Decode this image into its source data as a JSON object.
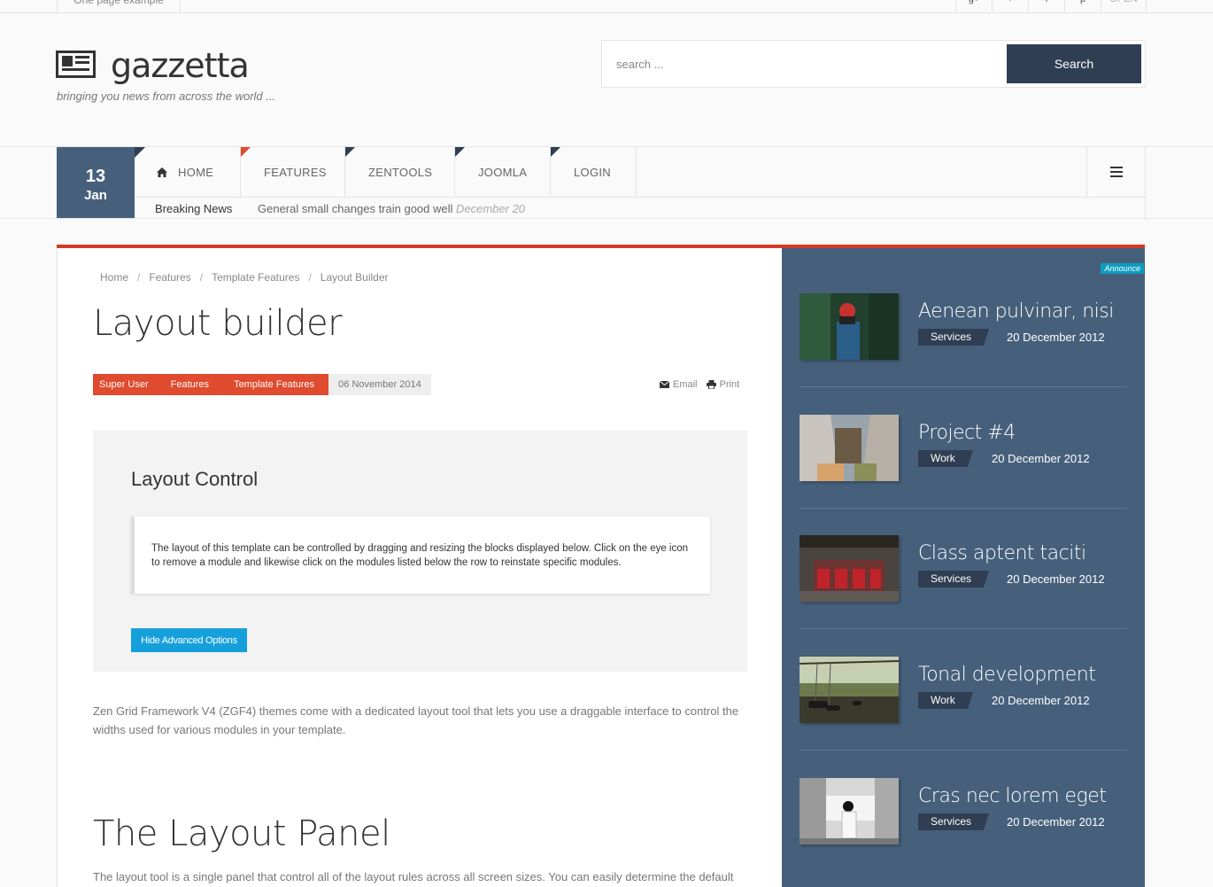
{
  "topbar": {
    "onepage": "One page example",
    "open": "OPEN"
  },
  "header": {
    "logo": "gazzetta",
    "tagline": "bringing you news from across the world ...",
    "search_placeholder": "search ...",
    "search_button": "Search"
  },
  "date": {
    "day": "13",
    "month": "Jan"
  },
  "menu": {
    "items": [
      {
        "label": "HOME",
        "icon": "home-icon"
      },
      {
        "label": "FEATURES"
      },
      {
        "label": "ZENTOOLS"
      },
      {
        "label": "JOOMLA"
      },
      {
        "label": "LOGIN"
      }
    ]
  },
  "breaking": {
    "label": "Breaking News",
    "text": "General small changes train good well",
    "date": "December 20"
  },
  "article": {
    "breadcrumb": [
      "Home",
      "Features",
      "Template Features",
      "Layout Builder"
    ],
    "title": "Layout builder",
    "author": "Super User",
    "cat1": "Features",
    "cat2": "Template Features",
    "date": "06 November 2014",
    "email": "Email",
    "print": "Print",
    "shot": {
      "heading": "Layout Control",
      "text": "The layout of this template can be controlled by dragging and resizing the blocks displayed below. Click on the eye icon to remove a module and likewise click on the modules listed below the row to reinstate specific modules.",
      "button": "Hide Advanced Options"
    },
    "para1": "Zen Grid Framework V4 (ZGF4) themes come with a dedicated layout tool that lets you use a draggable interface to control the widths used for various modules in your template.",
    "h2": "The Layout Panel",
    "para2": "The layout tool is a single panel that control all of the layout rules across all screen sizes. You can easily determine the default"
  },
  "sidebar": {
    "badge": "Announce",
    "posts": [
      {
        "title": "Aenean pulvinar, nisi",
        "cat": "Services",
        "date": "20 December 2012"
      },
      {
        "title": "Project #4",
        "cat": "Work",
        "date": "20 December 2012"
      },
      {
        "title": "Class aptent taciti",
        "cat": "Services",
        "date": "20 December 2012"
      },
      {
        "title": "Tonal development",
        "cat": "Work",
        "date": "20 December 2012"
      },
      {
        "title": "Cras nec lorem eget",
        "cat": "Services",
        "date": "20 December 2012"
      }
    ]
  }
}
